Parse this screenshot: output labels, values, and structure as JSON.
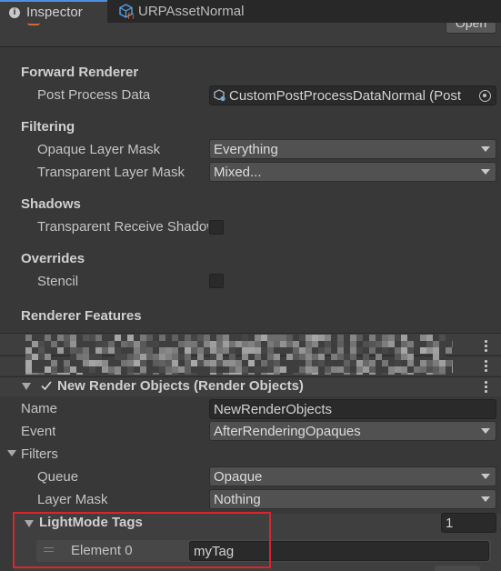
{
  "tabs": [
    {
      "label": "Inspector",
      "icon": "info-icon",
      "active": true
    },
    {
      "label": "URPAssetNormal",
      "icon": "urp-asset-icon",
      "active": false
    }
  ],
  "top_button": "Open",
  "sections": {
    "forward_renderer": {
      "title": "Forward Renderer",
      "post_process_label": "Post Process Data",
      "post_process_value": "CustomPostProcessDataNormal (Post"
    },
    "filtering": {
      "title": "Filtering",
      "opaque_label": "Opaque Layer Mask",
      "opaque_value": "Everything",
      "transparent_label": "Transparent Layer Mask",
      "transparent_value": "Mixed..."
    },
    "shadows": {
      "title": "Shadows",
      "receive_label": "Transparent Receive Shadows"
    },
    "overrides": {
      "title": "Overrides",
      "stencil_label": "Stencil"
    },
    "renderer_features": {
      "title": "Renderer Features"
    }
  },
  "feature": {
    "title": "New Render Objects (Render Objects)",
    "name_label": "Name",
    "name_value": "NewRenderObjects",
    "event_label": "Event",
    "event_value": "AfterRenderingOpaques",
    "filters_label": "Filters",
    "queue_label": "Queue",
    "queue_value": "Opaque",
    "layer_mask_label": "Layer Mask",
    "layer_mask_value": "Nothing",
    "lightmode_label": "LightMode Tags",
    "lightmode_count": "1",
    "element_label": "Element 0",
    "element_value": "myTag"
  },
  "colors": {
    "highlight_box": "#d8262b",
    "active_tab_accent": "#4e8fe0"
  }
}
